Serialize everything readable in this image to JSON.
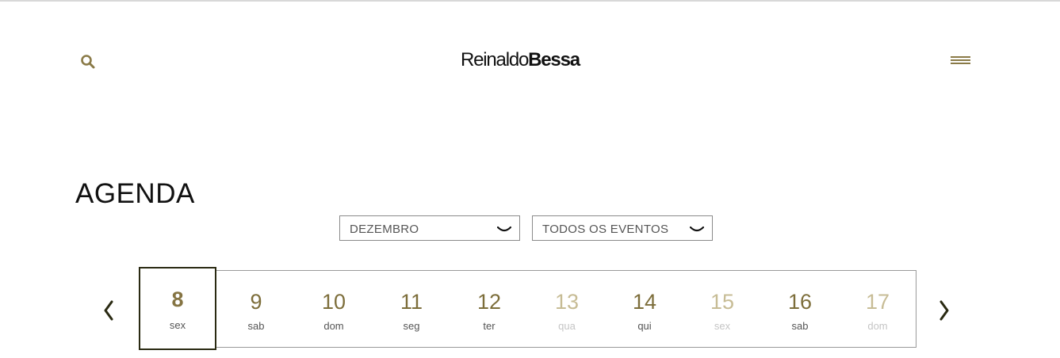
{
  "header": {
    "logo": {
      "part1": "Reinaldo",
      "part2": "Bessa"
    },
    "icons": {
      "search": "search-icon",
      "menu": "hamburger-menu-icon"
    }
  },
  "page": {
    "title": "AGENDA"
  },
  "filters": {
    "month": {
      "value": "DEZEMBRO",
      "icon": "chevron-down-icon"
    },
    "events": {
      "value": "TODOS OS EVENTOS",
      "icon": "chevron-down-icon"
    }
  },
  "calendar": {
    "prev_icon": "chevron-left-icon",
    "next_icon": "chevron-right-icon",
    "days": [
      {
        "num": "8",
        "weekday": "sex",
        "state": "selected"
      },
      {
        "num": "9",
        "weekday": "sab",
        "state": "dark"
      },
      {
        "num": "10",
        "weekday": "dom",
        "state": "dark"
      },
      {
        "num": "11",
        "weekday": "seg",
        "state": "dark"
      },
      {
        "num": "12",
        "weekday": "ter",
        "state": "dark"
      },
      {
        "num": "13",
        "weekday": "qua",
        "state": "faded"
      },
      {
        "num": "14",
        "weekday": "qui",
        "state": "dark"
      },
      {
        "num": "15",
        "weekday": "sex",
        "state": "faded"
      },
      {
        "num": "16",
        "weekday": "sab",
        "state": "dark"
      },
      {
        "num": "17",
        "weekday": "dom",
        "state": "faded"
      }
    ]
  },
  "colors": {
    "accent": "#8a7a47",
    "text": "#111111",
    "border": "#9a9a9a",
    "faded": "#c7bc95"
  }
}
